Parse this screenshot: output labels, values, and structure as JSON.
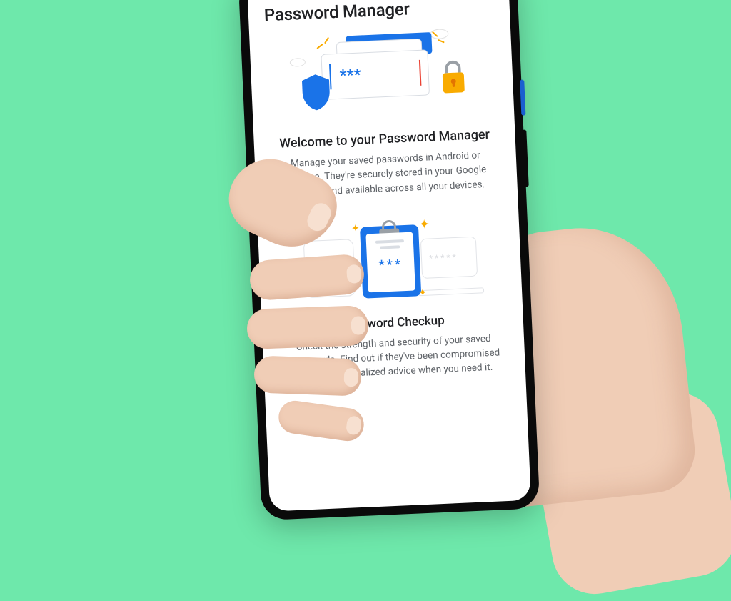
{
  "header": {
    "title": "Password Manager"
  },
  "welcome": {
    "heading": "Welcome to your Password Manager",
    "body": "Manage your saved passwords in Android or Chrome. They're securely stored in your Google Account and available across all your devices."
  },
  "checkup": {
    "heading": "Password Checkup",
    "body": "Check the strength and security of your saved passwords. Find out if they've been compromised and get personalized advice when you need it."
  },
  "illustration": {
    "masked_password": "***",
    "clipboard_password": "***"
  },
  "colors": {
    "background": "#6ee8ab",
    "primary_blue": "#1a73e8",
    "accent_yellow": "#f9ab00",
    "text_primary": "#202124",
    "text_secondary": "#5f6368"
  }
}
